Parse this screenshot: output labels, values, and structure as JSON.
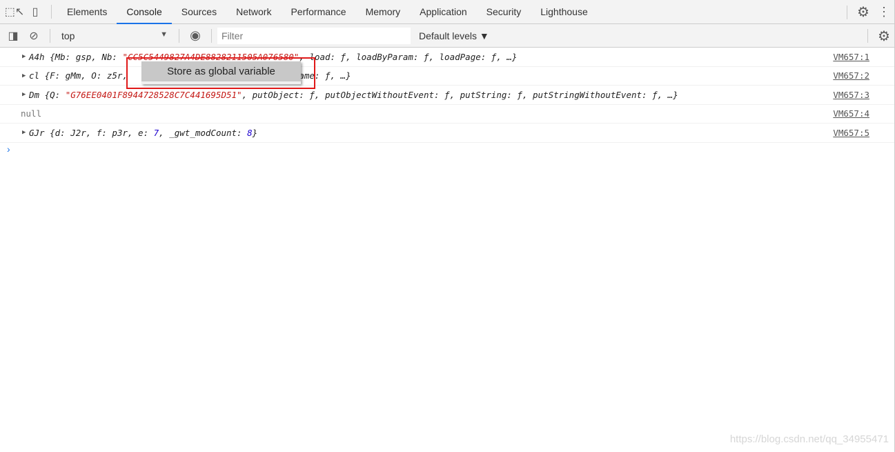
{
  "tabs": [
    "Elements",
    "Console",
    "Sources",
    "Network",
    "Performance",
    "Memory",
    "Application",
    "Security",
    "Lighthouse"
  ],
  "active_tab": "Console",
  "toolbar": {
    "context": "top",
    "filter_placeholder": "Filter",
    "levels": "Default levels ▼"
  },
  "lines": [
    {
      "expandable": true,
      "parts": [
        [
          "A4h ",
          ""
        ],
        [
          "{Mb: gsp, Nb: ",
          ""
        ],
        [
          "\"CC5C5449827A4DE8828211505A076580\"",
          "str"
        ],
        [
          ", load: ƒ, loadByParam: ƒ, loadPage: ƒ, …}",
          ""
        ]
      ],
      "source": "VM657:1"
    },
    {
      "expandable": true,
      "parts": [
        [
          "cl ",
          ""
        ],
        [
          "{F: gMm, O: z5r, ",
          ""
        ],
        [
          "                    ƒ, setTableName: ƒ, …}",
          ""
        ]
      ],
      "source": "VM657:2"
    },
    {
      "expandable": true,
      "parts": [
        [
          "Dm ",
          ""
        ],
        [
          "{Q: ",
          ""
        ],
        [
          "\"G76EE0401F8944728528C7C441695D51\"",
          "str"
        ],
        [
          ", putObject: ƒ, putObjectWithoutEvent: ƒ, putString: ƒ, putStringWithoutEvent: ƒ, …}",
          ""
        ]
      ],
      "source": "VM657:3"
    },
    {
      "expandable": false,
      "parts": [
        [
          "null",
          ""
        ]
      ],
      "source": "VM657:4"
    },
    {
      "expandable": true,
      "parts": [
        [
          "GJr ",
          ""
        ],
        [
          "{d: J2r, f: p3r, e: ",
          ""
        ],
        [
          "7",
          "num"
        ],
        [
          ", _gwt_modCount: ",
          ""
        ],
        [
          "8",
          "num"
        ],
        [
          "}",
          ""
        ]
      ],
      "source": "VM657:5"
    }
  ],
  "context_menu": {
    "items": [
      "Store as global variable"
    ]
  },
  "watermark": "https://blog.csdn.net/qq_34955471"
}
